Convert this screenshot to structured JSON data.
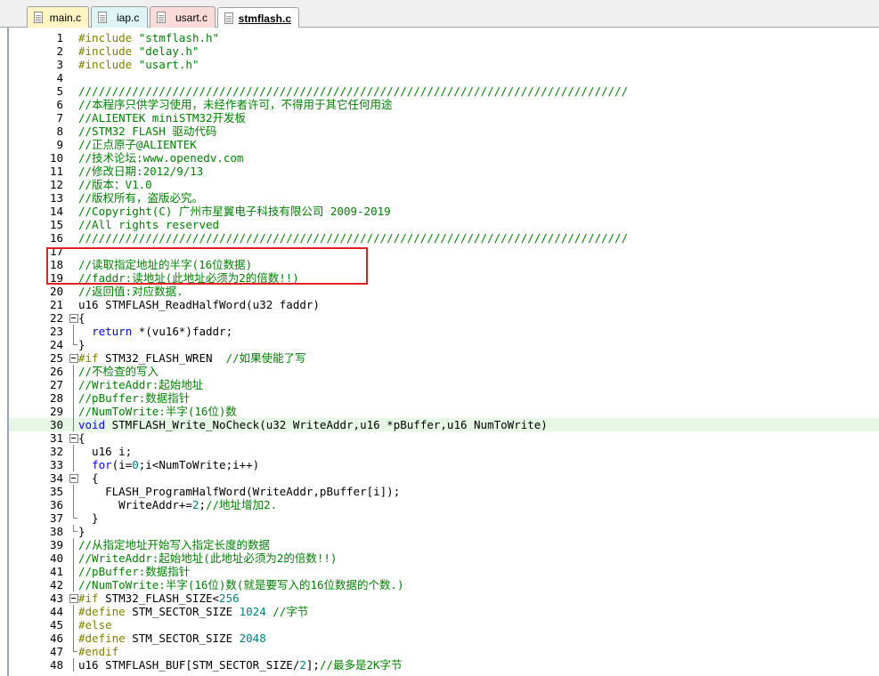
{
  "tabs": [
    {
      "label": "main.c",
      "bg": "#fff5c4",
      "active": false
    },
    {
      "label": "iap.c",
      "bg": "#dff5f5",
      "active": false
    },
    {
      "label": "usart.c",
      "bg": "#fbdada",
      "active": false
    },
    {
      "label": "stmflash.c",
      "bg": "#e6e1f5",
      "active": true
    }
  ],
  "colors": {
    "comment": "#008000",
    "preprocessor": "#808000",
    "keyword": "#0000ff",
    "number": "#008080",
    "highlight_line": "#e6f7e6",
    "annotation_box": "#e02020"
  },
  "highlighted_line": 30,
  "lines": [
    {
      "n": "1",
      "fold": "",
      "tokens": [
        [
          "p",
          "#include "
        ],
        [
          "c",
          "\"stmflash.h\""
        ]
      ]
    },
    {
      "n": "2",
      "fold": "",
      "tokens": [
        [
          "p",
          "#include "
        ],
        [
          "c",
          "\"delay.h\""
        ]
      ]
    },
    {
      "n": "3",
      "fold": "",
      "tokens": [
        [
          "p",
          "#include "
        ],
        [
          "c",
          "\"usart.h\""
        ]
      ]
    },
    {
      "n": "4",
      "fold": "",
      "tokens": []
    },
    {
      "n": "5",
      "fold": "",
      "tokens": [
        [
          "c",
          "//////////////////////////////////////////////////////////////////////////////////"
        ]
      ]
    },
    {
      "n": "6",
      "fold": "",
      "tokens": [
        [
          "c",
          "//本程序只供学习使用，未经作者许可，不得用于其它任何用途"
        ]
      ]
    },
    {
      "n": "7",
      "fold": "",
      "tokens": [
        [
          "c",
          "//ALIENTEK miniSTM32开发板"
        ]
      ]
    },
    {
      "n": "8",
      "fold": "",
      "tokens": [
        [
          "c",
          "//STM32 FLASH 驱动代码"
        ]
      ]
    },
    {
      "n": "9",
      "fold": "",
      "tokens": [
        [
          "c",
          "//正点原子@ALIENTEK"
        ]
      ]
    },
    {
      "n": "10",
      "fold": "",
      "tokens": [
        [
          "c",
          "//技术论坛:www.openedv.com"
        ]
      ]
    },
    {
      "n": "11",
      "fold": "",
      "tokens": [
        [
          "c",
          "//修改日期:2012/9/13"
        ]
      ]
    },
    {
      "n": "12",
      "fold": "",
      "tokens": [
        [
          "c",
          "//版本：V1.0"
        ]
      ]
    },
    {
      "n": "13",
      "fold": "",
      "tokens": [
        [
          "c",
          "//版权所有，盗版必究。"
        ]
      ]
    },
    {
      "n": "14",
      "fold": "",
      "tokens": [
        [
          "c",
          "//Copyright(C) 广州市星翼电子科技有限公司 2009-2019"
        ]
      ]
    },
    {
      "n": "15",
      "fold": "",
      "tokens": [
        [
          "c",
          "//All rights reserved"
        ]
      ]
    },
    {
      "n": "16",
      "fold": "",
      "tokens": [
        [
          "c",
          "//////////////////////////////////////////////////////////////////////////////////"
        ]
      ]
    },
    {
      "n": "17",
      "fold": "",
      "tokens": []
    },
    {
      "n": "18",
      "fold": "",
      "tokens": [
        [
          "c",
          "//读取指定地址的半字(16位数据)"
        ]
      ]
    },
    {
      "n": "19",
      "fold": "",
      "tokens": [
        [
          "c",
          "//faddr:读地址(此地址必须为2的倍数!!)"
        ]
      ]
    },
    {
      "n": "20",
      "fold": "",
      "tokens": [
        [
          "c",
          "//返回值:对应数据."
        ]
      ]
    },
    {
      "n": "21",
      "fold": "",
      "tokens": [
        [
          "t",
          "u16 STMFLASH_ReadHalfWord(u32 faddr)"
        ]
      ]
    },
    {
      "n": "22",
      "fold": "box",
      "tokens": [
        [
          "t",
          "{"
        ]
      ]
    },
    {
      "n": "23",
      "fold": "vline",
      "tokens": [
        [
          "t",
          "  "
        ],
        [
          "k",
          "return"
        ],
        [
          "t",
          " *(vu16*)faddr;"
        ]
      ]
    },
    {
      "n": "24",
      "fold": "end",
      "tokens": [
        [
          "t",
          "}"
        ]
      ]
    },
    {
      "n": "25",
      "fold": "box",
      "tokens": [
        [
          "p",
          "#if"
        ],
        [
          "t",
          " STM32_FLASH_WREN  "
        ],
        [
          "c",
          "//如果使能了写"
        ]
      ]
    },
    {
      "n": "26",
      "fold": "vline",
      "tokens": [
        [
          "c",
          "//不检查的写入"
        ]
      ]
    },
    {
      "n": "27",
      "fold": "vline",
      "tokens": [
        [
          "c",
          "//WriteAddr:起始地址"
        ]
      ]
    },
    {
      "n": "28",
      "fold": "vline",
      "tokens": [
        [
          "c",
          "//pBuffer:数据指针"
        ]
      ]
    },
    {
      "n": "29",
      "fold": "vline",
      "tokens": [
        [
          "c",
          "//NumToWrite:半字(16位)数"
        ]
      ]
    },
    {
      "n": "30",
      "fold": "vline",
      "tokens": [
        [
          "k",
          "void"
        ],
        [
          "t",
          " STMFLASH_Write_NoCheck(u32 WriteAddr,u16 *pBuffer,u16 NumToWrite)"
        ]
      ]
    },
    {
      "n": "31",
      "fold": "box",
      "tokens": [
        [
          "t",
          "{"
        ]
      ]
    },
    {
      "n": "32",
      "fold": "vline",
      "tokens": [
        [
          "t",
          "  u16 i;"
        ]
      ]
    },
    {
      "n": "33",
      "fold": "vline",
      "tokens": [
        [
          "t",
          "  "
        ],
        [
          "k",
          "for"
        ],
        [
          "t",
          "(i="
        ],
        [
          "n",
          "0"
        ],
        [
          "t",
          ";i<NumToWrite;i++)"
        ]
      ]
    },
    {
      "n": "34",
      "fold": "box",
      "tokens": [
        [
          "t",
          "  {"
        ]
      ]
    },
    {
      "n": "35",
      "fold": "vline",
      "tokens": [
        [
          "t",
          "    FLASH_ProgramHalfWord(WriteAddr,pBuffer[i]);"
        ]
      ]
    },
    {
      "n": "36",
      "fold": "vline",
      "tokens": [
        [
          "t",
          "      WriteAddr+="
        ],
        [
          "n",
          "2"
        ],
        [
          "t",
          ";"
        ],
        [
          "c",
          "//地址增加2."
        ]
      ]
    },
    {
      "n": "37",
      "fold": "end",
      "tokens": [
        [
          "t",
          "  }"
        ]
      ]
    },
    {
      "n": "38",
      "fold": "end",
      "tokens": [
        [
          "t",
          "}"
        ]
      ]
    },
    {
      "n": "39",
      "fold": "vline",
      "tokens": [
        [
          "c",
          "//从指定地址开始写入指定长度的数据"
        ]
      ]
    },
    {
      "n": "40",
      "fold": "vline",
      "tokens": [
        [
          "c",
          "//WriteAddr:起始地址(此地址必须为2的倍数!!)"
        ]
      ]
    },
    {
      "n": "41",
      "fold": "vline",
      "tokens": [
        [
          "c",
          "//pBuffer:数据指针"
        ]
      ]
    },
    {
      "n": "42",
      "fold": "vline",
      "tokens": [
        [
          "c",
          "//NumToWrite:半字(16位)数(就是要写入的16位数据的个数.)"
        ]
      ]
    },
    {
      "n": "43",
      "fold": "box",
      "tokens": [
        [
          "p",
          "#if"
        ],
        [
          "t",
          " STM32_FLASH_SIZE<"
        ],
        [
          "n",
          "256"
        ]
      ]
    },
    {
      "n": "44",
      "fold": "vline",
      "tokens": [
        [
          "p",
          "#define"
        ],
        [
          "t",
          " STM_SECTOR_SIZE "
        ],
        [
          "n",
          "1024"
        ],
        [
          "t",
          " "
        ],
        [
          "c",
          "//字节"
        ]
      ]
    },
    {
      "n": "45",
      "fold": "vline",
      "tokens": [
        [
          "p",
          "#else"
        ]
      ]
    },
    {
      "n": "46",
      "fold": "vline",
      "tokens": [
        [
          "p",
          "#define"
        ],
        [
          "t",
          " STM_SECTOR_SIZE "
        ],
        [
          "n",
          "2048"
        ]
      ]
    },
    {
      "n": "47",
      "fold": "end",
      "tokens": [
        [
          "p",
          "#endif"
        ]
      ]
    },
    {
      "n": "48",
      "fold": "vline",
      "tokens": [
        [
          "t",
          "u16 STMFLASH_BUF[STM_SECTOR_SIZE/"
        ],
        [
          "n",
          "2"
        ],
        [
          "t",
          "];"
        ],
        [
          "c",
          "//最多是2K字节"
        ]
      ]
    }
  ]
}
